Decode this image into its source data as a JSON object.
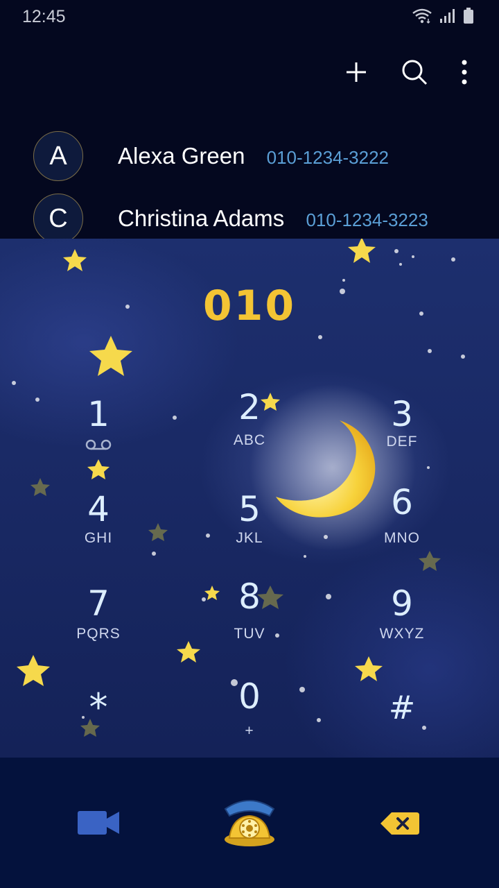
{
  "status": {
    "time": "12:45"
  },
  "actions": {
    "add_icon": "plus-icon",
    "search_icon": "search-icon",
    "menu_icon": "more-vert-icon"
  },
  "contacts": [
    {
      "initial": "A",
      "name": "Alexa Green",
      "number": "010-1234-3222"
    },
    {
      "initial": "C",
      "name": "Christina Adams",
      "number": "010-1234-3223"
    }
  ],
  "dialer": {
    "entered_number": "010",
    "keys": [
      {
        "digit": "1",
        "letters": ""
      },
      {
        "digit": "2",
        "letters": "ABC"
      },
      {
        "digit": "3",
        "letters": "DEF"
      },
      {
        "digit": "4",
        "letters": "GHI"
      },
      {
        "digit": "5",
        "letters": "JKL"
      },
      {
        "digit": "6",
        "letters": "MNO"
      },
      {
        "digit": "7",
        "letters": "PQRS"
      },
      {
        "digit": "8",
        "letters": "TUV"
      },
      {
        "digit": "9",
        "letters": "WXYZ"
      },
      {
        "digit": "*",
        "letters": ""
      },
      {
        "digit": "0",
        "letters": "+"
      },
      {
        "digit": "#",
        "letters": ""
      }
    ]
  },
  "colors": {
    "accent": "#f3c434",
    "number_blue": "#5b9fd6",
    "bottom_bar": "#04123d"
  }
}
